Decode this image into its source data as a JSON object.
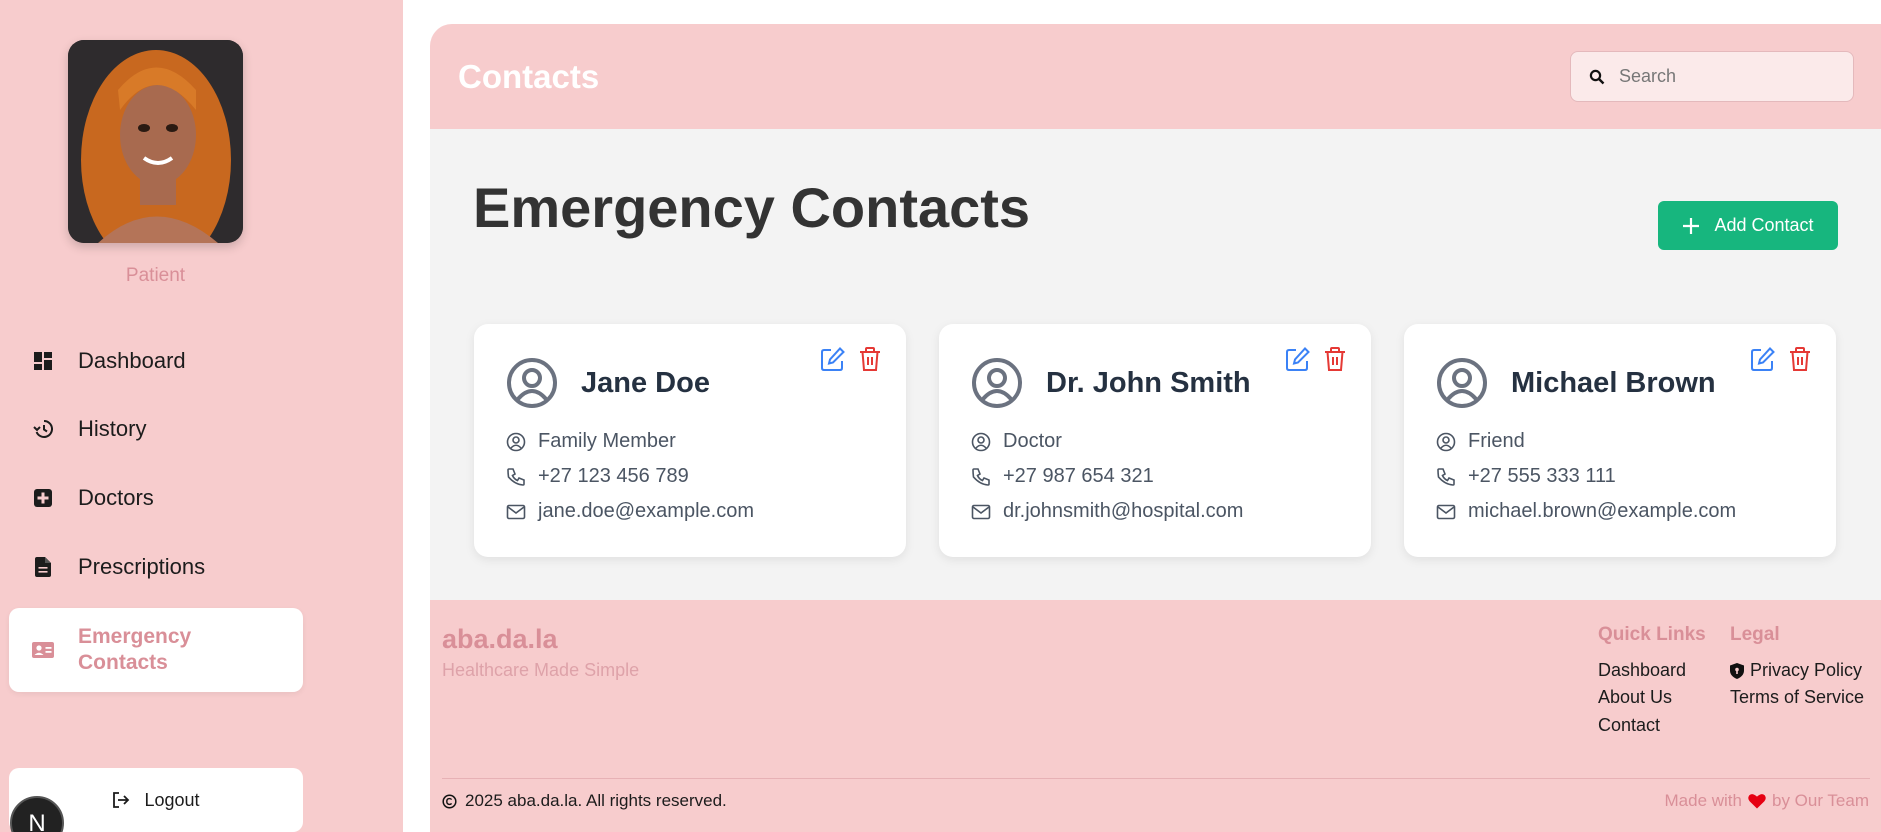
{
  "sidebar": {
    "role": "Patient",
    "nav": [
      {
        "label": "Dashboard",
        "icon": "dashboard-icon"
      },
      {
        "label": "History",
        "icon": "history-icon"
      },
      {
        "label": "Doctors",
        "icon": "medical-plus-icon"
      },
      {
        "label": "Prescriptions",
        "icon": "document-icon"
      },
      {
        "label": "Emergency\nContacts",
        "icon": "contact-card-icon",
        "active": true
      }
    ],
    "logout_label": "Logout",
    "badge_letter": "N"
  },
  "header": {
    "title": "Contacts",
    "search_placeholder": "Search"
  },
  "main": {
    "title": "Emergency Contacts",
    "add_label": "Add Contact"
  },
  "contacts": [
    {
      "name": "Jane Doe",
      "relation": "Family Member",
      "phone": "+27 123 456 789",
      "email": "jane.doe@example.com"
    },
    {
      "name": "Dr. John Smith",
      "relation": "Doctor",
      "phone": "+27 987 654 321",
      "email": "dr.johnsmith@hospital.com"
    },
    {
      "name": "Michael Brown",
      "relation": "Friend",
      "phone": "+27 555 333 111",
      "email": "michael.brown@example.com"
    }
  ],
  "footer": {
    "brand": "aba.da.la",
    "tagline": "Healthcare Made Simple",
    "quick_links_title": "Quick Links",
    "quick_links": [
      "Dashboard",
      "About Us",
      "Contact"
    ],
    "legal_title": "Legal",
    "legal_links": [
      "Privacy Policy",
      "Terms of Service"
    ],
    "copyright": "2025 aba.da.la. All rights reserved.",
    "made_with_prefix": "Made with",
    "made_with_suffix": "by Our Team"
  },
  "colors": {
    "pink": "#f7cccd",
    "accent_pink": "#d98f98",
    "green": "#17b67e",
    "edit_blue": "#3b82f6",
    "delete_red": "#e53935"
  }
}
